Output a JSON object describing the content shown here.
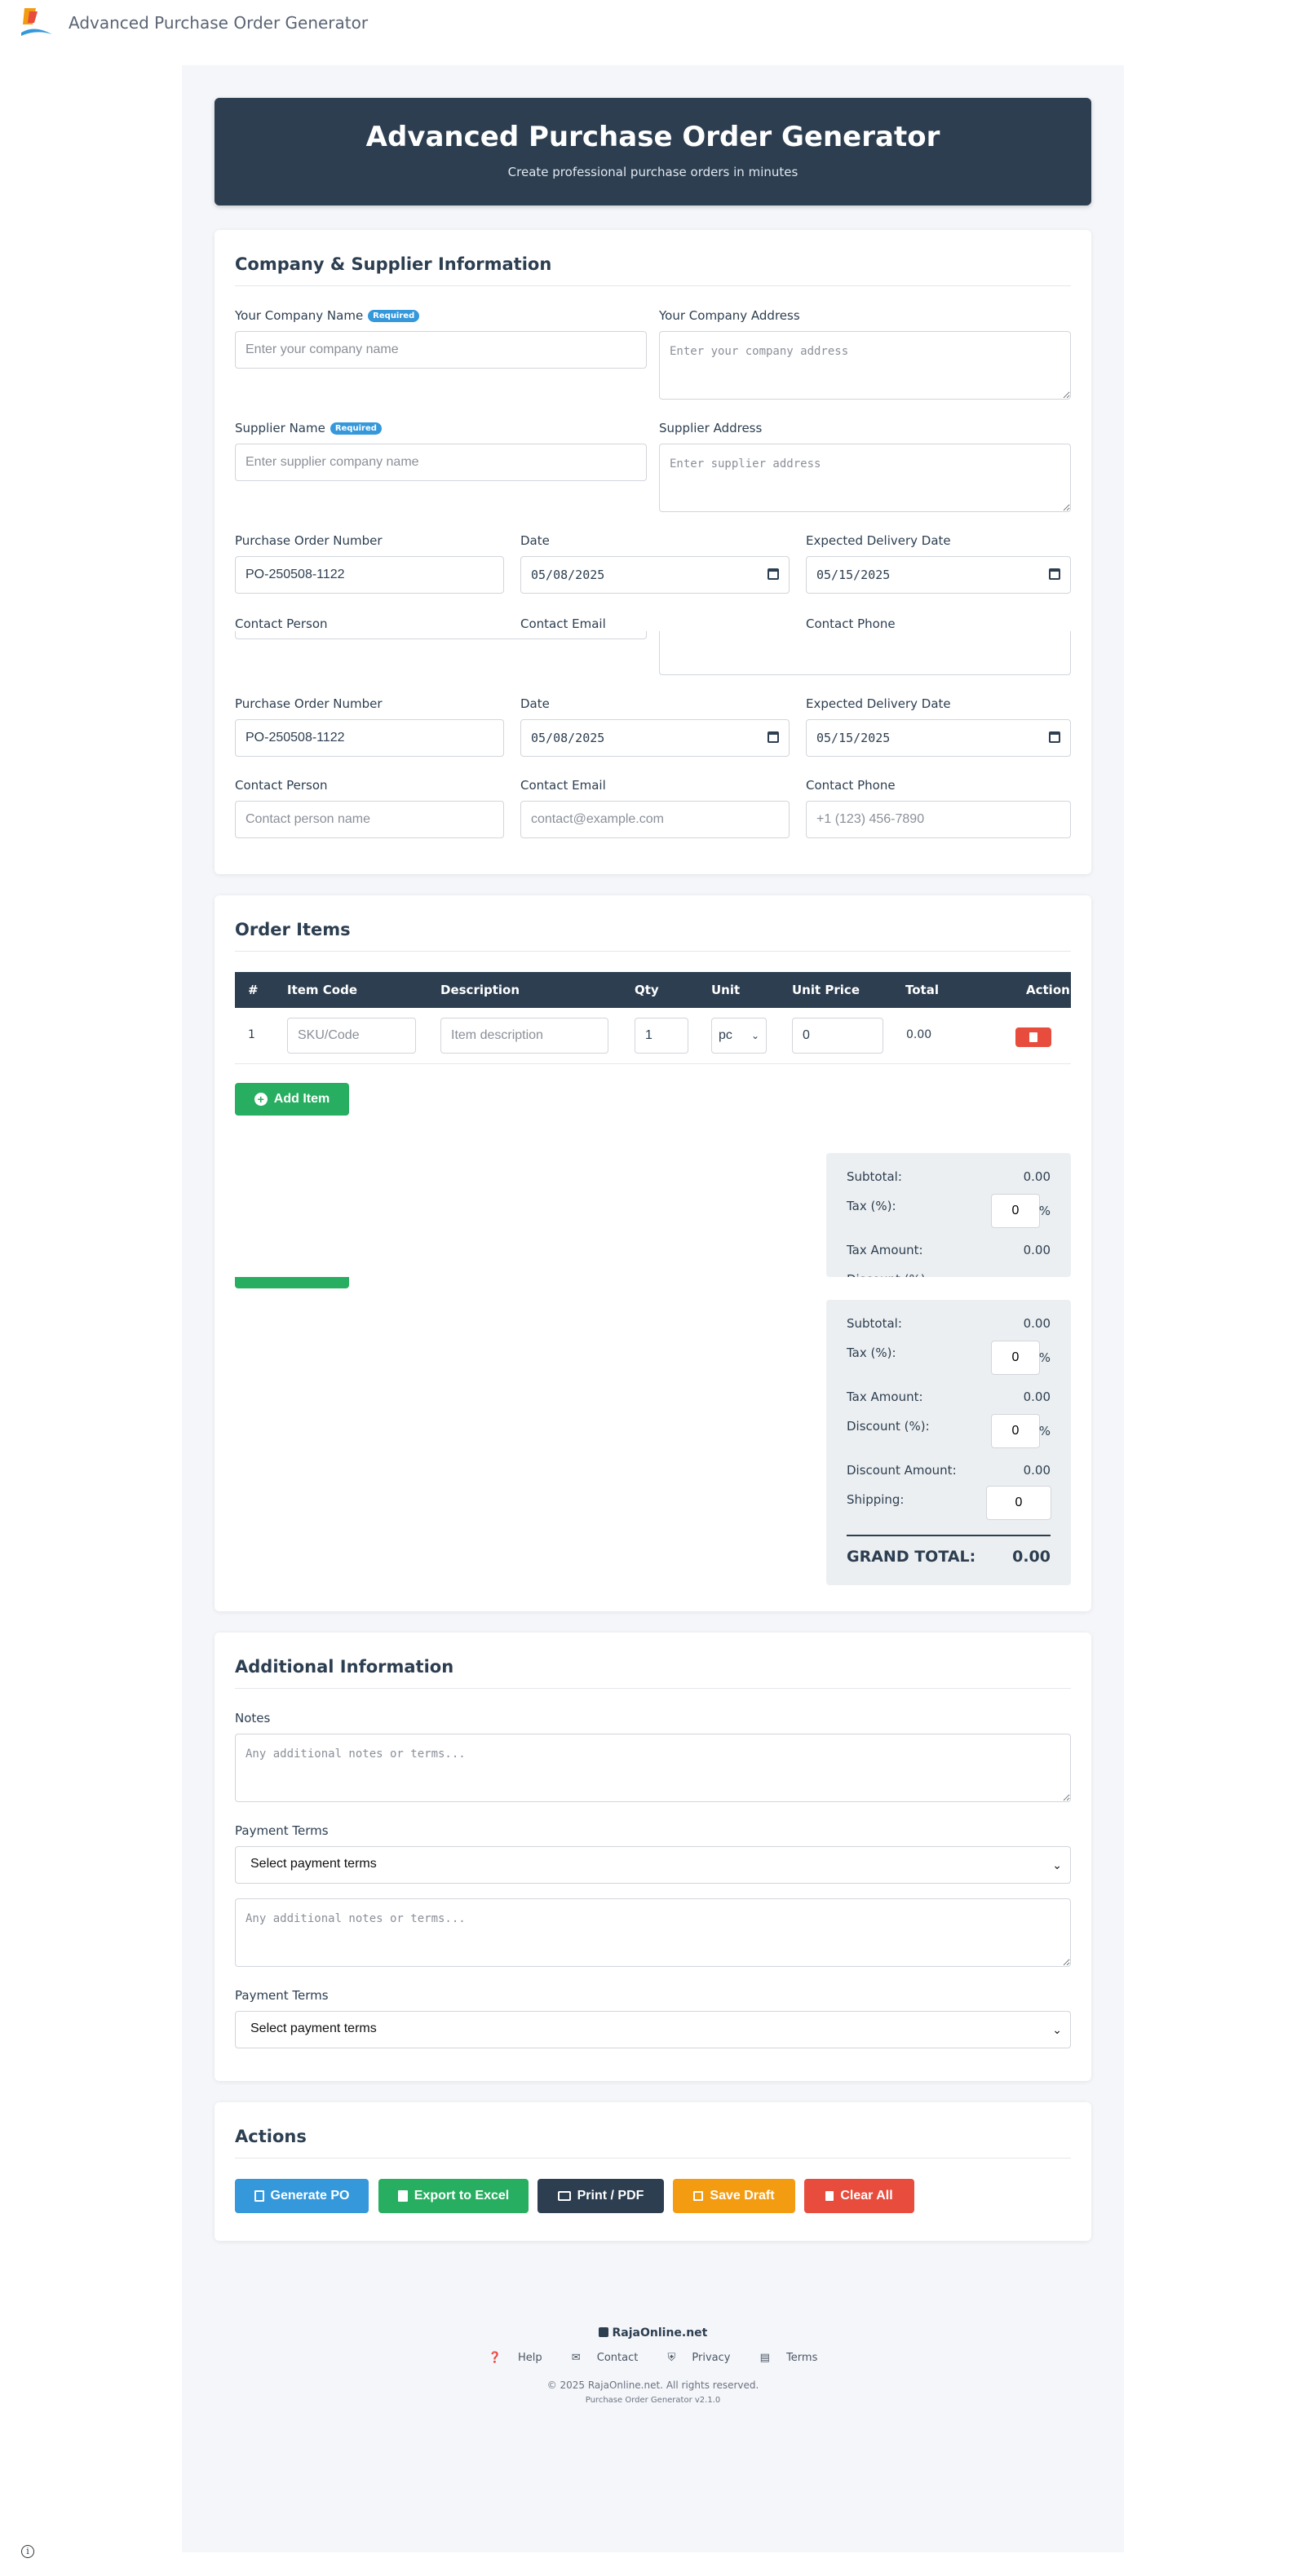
{
  "topbar": {
    "title": "Advanced Purchase Order Generator"
  },
  "header": {
    "title": "Advanced Purchase Order Generator",
    "subtitle": "Create professional purchase orders in minutes"
  },
  "company": {
    "section_title": "Company & Supplier Information",
    "company_name_label": "Your Company Name",
    "required_badge": "Required",
    "company_name_placeholder": "Enter your company name",
    "company_address_label": "Your Company Address",
    "company_address_placeholder": "Enter your company address",
    "supplier_name_label": "Supplier Name",
    "supplier_name_placeholder": "Enter supplier company name",
    "supplier_address_label": "Supplier Address",
    "supplier_address_placeholder": "Enter supplier address",
    "po_number_label": "Purchase Order Number",
    "po_number_value": "PO-250508-1122",
    "date_label": "Date",
    "date_value": "05/08/2025",
    "delivery_label": "Expected Delivery Date",
    "delivery_value": "05/15/2025",
    "contact_person_label": "Contact Person",
    "contact_person_placeholder": "Contact person name",
    "contact_email_label": "Contact Email",
    "contact_email_placeholder": "contact@example.com",
    "contact_phone_label": "Contact Phone",
    "contact_phone_placeholder": "+1 (123) 456-7890"
  },
  "items": {
    "section_title": "Order Items",
    "columns": [
      "#",
      "Item Code",
      "Description",
      "Qty",
      "Unit",
      "Unit Price",
      "Total",
      "Action"
    ],
    "row": {
      "index": "1",
      "code_placeholder": "SKU/Code",
      "desc_placeholder": "Item description",
      "qty": "1",
      "unit": "pc",
      "unit_price": "0",
      "total": "0.00"
    },
    "add_button": "Add Item"
  },
  "totals": {
    "subtotal_label": "Subtotal:",
    "subtotal_value": "0.00",
    "tax_label": "Tax (%):",
    "tax_value": "0",
    "percent": "%",
    "tax_amount_label": "Tax Amount:",
    "tax_amount_value": "0.00",
    "discount_label": "Discount (%):",
    "discount_value": "0",
    "discount_amount_label": "Discount Amount:",
    "discount_amount_value": "0.00",
    "shipping_label": "Shipping:",
    "shipping_value": "0",
    "grand_total_label": "GRAND TOTAL:",
    "grand_total_value": "0.00"
  },
  "additional": {
    "section_title": "Additional Information",
    "notes_label": "Notes",
    "notes_placeholder": "Any additional notes or terms...",
    "payment_terms_label": "Payment Terms",
    "payment_terms_value": "Select payment terms"
  },
  "actions": {
    "section_title": "Actions",
    "generate": "Generate PO",
    "export": "Export to Excel",
    "print": "Print / PDF",
    "save": "Save Draft",
    "clear": "Clear All"
  },
  "footer": {
    "brand": "RajaOnline.net",
    "links": [
      "Help",
      "Contact",
      "Privacy",
      "Terms"
    ],
    "copyright": "© 2025 RajaOnline.net. All rights reserved.",
    "version": "Purchase Order Generator v2.1.0"
  },
  "colors": {
    "dark": "#2c3e50",
    "blue": "#3498db",
    "green": "#27ae60",
    "orange": "#f39c12",
    "red": "#e74c3c"
  }
}
